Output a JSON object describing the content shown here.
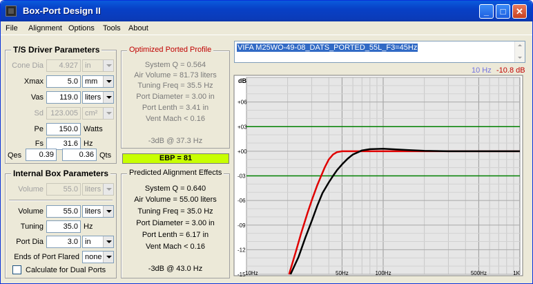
{
  "window": {
    "title": "Box-Port Design II",
    "minimize": "_",
    "maximize": "□",
    "close": "✕"
  },
  "menu": [
    "File",
    "Alignment",
    "Options",
    "Tools",
    "About"
  ],
  "driver": {
    "heading": "T/S Driver Parameters",
    "cone_dia": {
      "label": "Cone Dia",
      "value": "4.927",
      "unit": "in"
    },
    "xmax": {
      "label": "Xmax",
      "value": "5.0",
      "unit": "mm"
    },
    "vas": {
      "label": "Vas",
      "value": "119.0",
      "unit": "liters"
    },
    "sd": {
      "label": "Sd",
      "value": "123.005",
      "unit": "cm²"
    },
    "pe": {
      "label": "Pe",
      "value": "150.0",
      "unit": "Watts"
    },
    "fs": {
      "label": "Fs",
      "value": "31.6",
      "unit": "Hz"
    },
    "qes": {
      "label": "Qes",
      "value": "0.39"
    },
    "qts": {
      "value": "0.36",
      "label": "Qts"
    }
  },
  "box": {
    "heading": "Internal Box Parameters",
    "volume_dis": {
      "label": "Volume",
      "value": "55.0",
      "unit": "liters"
    },
    "volume": {
      "label": "Volume",
      "value": "55.0",
      "unit": "liters"
    },
    "tuning": {
      "label": "Tuning",
      "value": "35.0",
      "unit": "Hz"
    },
    "port_dia": {
      "label": "Port Dia",
      "value": "3.0",
      "unit": "in"
    },
    "flared": {
      "label": "Ends of Port Flared",
      "value": "none"
    },
    "dual": {
      "label": "Calculate for Dual Ports",
      "checked": false
    }
  },
  "optimized": {
    "heading": "Optimized Ported Profile",
    "lines": [
      "System Q = 0.564",
      "Air Volume = 81.73 liters",
      "Tuning Freq = 35.5 Hz",
      "Port Diameter = 3.00 in",
      "Port Lenth = 3.41 in",
      "Vent Mach < 0.16"
    ],
    "f3": "-3dB @ 37.3 Hz"
  },
  "ebp": "EBP = 81",
  "predicted": {
    "heading": "Predicted Alignment Effects",
    "lines": [
      "System Q = 0.640",
      "Air Volume = 55.00 liters",
      "Tuning Freq = 35.0 Hz",
      "Port Diameter = 3.00 in",
      "Port Lenth = 6.17 in",
      "Vent Mach < 0.16"
    ],
    "f3": "-3dB @ 43.0 Hz"
  },
  "design_name": "VIFA M25WO-49-08_DATS_PORTED_55L_F3=45Hz",
  "readout": {
    "freq": "10 Hz",
    "db": "-10.8 dB"
  },
  "colors": {
    "titlebar": "#0a4fd4",
    "ebp": "#c8ff00",
    "curve_opt": "#e00000",
    "curve_pred": "#000000",
    "guide": "#008000",
    "grid": "#c8c8c8",
    "readout_freq": "#7070e0",
    "readout_db": "#c00000"
  },
  "chart_data": {
    "type": "line",
    "ylabel": "dB",
    "x_scale": "log",
    "xlim": [
      10,
      1000
    ],
    "ylim": [
      -15,
      9
    ],
    "y_ticks": [
      "+06",
      "+03",
      "+00",
      "-03",
      "-06",
      "-09",
      "-12",
      "-15"
    ],
    "y_tick_values": [
      6,
      3,
      0,
      -3,
      -6,
      -9,
      -12,
      -15
    ],
    "x_ticks": [
      "10Hz",
      "50Hz",
      "100Hz",
      "500Hz",
      "1K"
    ],
    "x_tick_values": [
      10,
      50,
      100,
      500,
      1000
    ],
    "guides": [
      3,
      -3
    ],
    "series": [
      {
        "color": "#e00000",
        "x": [
          20.5,
          23,
          25,
          28,
          30,
          33,
          35,
          37.3,
          40,
          43,
          46,
          50,
          60,
          80,
          100,
          200,
          500,
          1000
        ],
        "y": [
          -15,
          -12.2,
          -10.1,
          -7.5,
          -6.0,
          -4.1,
          -3.1,
          -2.0,
          -1.0,
          -0.4,
          -0.1,
          0,
          0,
          0,
          0,
          0,
          0,
          0
        ]
      },
      {
        "color": "#000000",
        "x": [
          21,
          24,
          27,
          30,
          33,
          36,
          40,
          43,
          46,
          50,
          55,
          60,
          70,
          80,
          100,
          150,
          200,
          300,
          500,
          1000
        ],
        "y": [
          -15,
          -12.9,
          -10.5,
          -8.5,
          -6.6,
          -5.1,
          -3.8,
          -3.0,
          -2.3,
          -1.6,
          -0.9,
          -0.4,
          0.1,
          0.25,
          0.3,
          0.15,
          0.05,
          0,
          0,
          0
        ]
      }
    ]
  }
}
